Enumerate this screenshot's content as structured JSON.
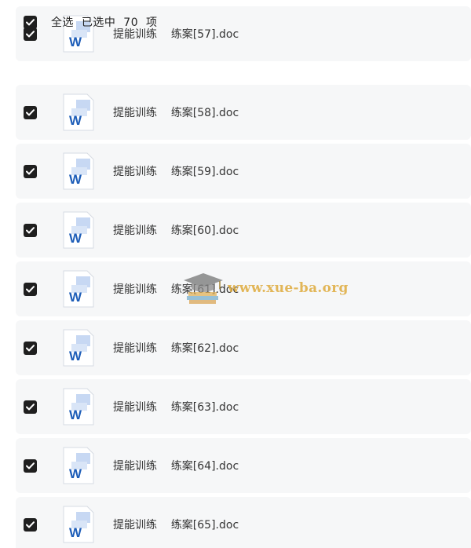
{
  "header": {
    "select_all_label": "全选  已选中  70  项",
    "checked": true
  },
  "files": [
    {
      "prefix": "提能训练",
      "name": "练案[57].doc",
      "checked": true
    },
    {
      "prefix": "提能训练",
      "name": "练案[58].doc",
      "checked": true
    },
    {
      "prefix": "提能训练",
      "name": "练案[59].doc",
      "checked": true
    },
    {
      "prefix": "提能训练",
      "name": "练案[60].doc",
      "checked": true
    },
    {
      "prefix": "提能训练",
      "name": "练案[61].doc",
      "checked": true
    },
    {
      "prefix": "提能训练",
      "name": "练案[62].doc",
      "checked": true
    },
    {
      "prefix": "提能训练",
      "name": "练案[63].doc",
      "checked": true
    },
    {
      "prefix": "提能训练",
      "name": "练案[64].doc",
      "checked": true
    },
    {
      "prefix": "提能训练",
      "name": "练案[65].doc",
      "checked": true
    }
  ],
  "file_icon": "word-doc-icon",
  "watermark": {
    "text": "www.xue-ba.org",
    "logo_icon": "graduation-cap-books-icon"
  },
  "colors": {
    "row_background": "#f6f7f8",
    "checkbox": "#1f1f1f",
    "word_blue": "#1d5db8",
    "watermark": "#deaa3c"
  }
}
